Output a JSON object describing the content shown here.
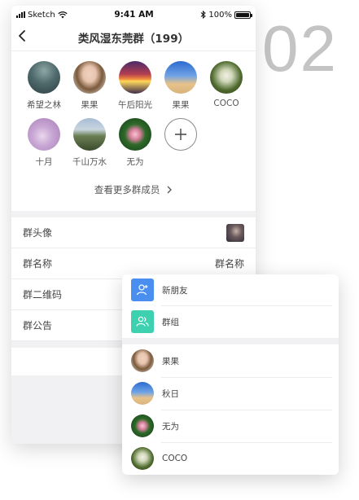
{
  "big_number": "02",
  "status": {
    "carrier": "Sketch",
    "time": "9:41 AM",
    "battery": "100%"
  },
  "nav": {
    "title": "类风湿东莞群（199）"
  },
  "members": [
    {
      "name": "希望之林"
    },
    {
      "name": "果果"
    },
    {
      "name": "午后阳光"
    },
    {
      "name": "果果"
    },
    {
      "name": "COCO"
    },
    {
      "name": "十月"
    },
    {
      "name": "千山万水"
    },
    {
      "name": "无为"
    }
  ],
  "more_members": "查看更多群成员",
  "settings": {
    "avatar_label": "群头像",
    "name_label": "群名称",
    "name_value": "群名称",
    "qr_label": "群二维码",
    "notice_label": "群公告"
  },
  "popup": {
    "top_items": [
      {
        "label": "新朋友"
      },
      {
        "label": "群组"
      }
    ],
    "contacts": [
      {
        "label": "果果"
      },
      {
        "label": "秋日"
      },
      {
        "label": "无为"
      },
      {
        "label": "COCO"
      }
    ]
  },
  "colors": {
    "accent_blue": "#4a8ff0",
    "accent_teal": "#3dd1b0",
    "big_number": "#c4c4c4"
  }
}
